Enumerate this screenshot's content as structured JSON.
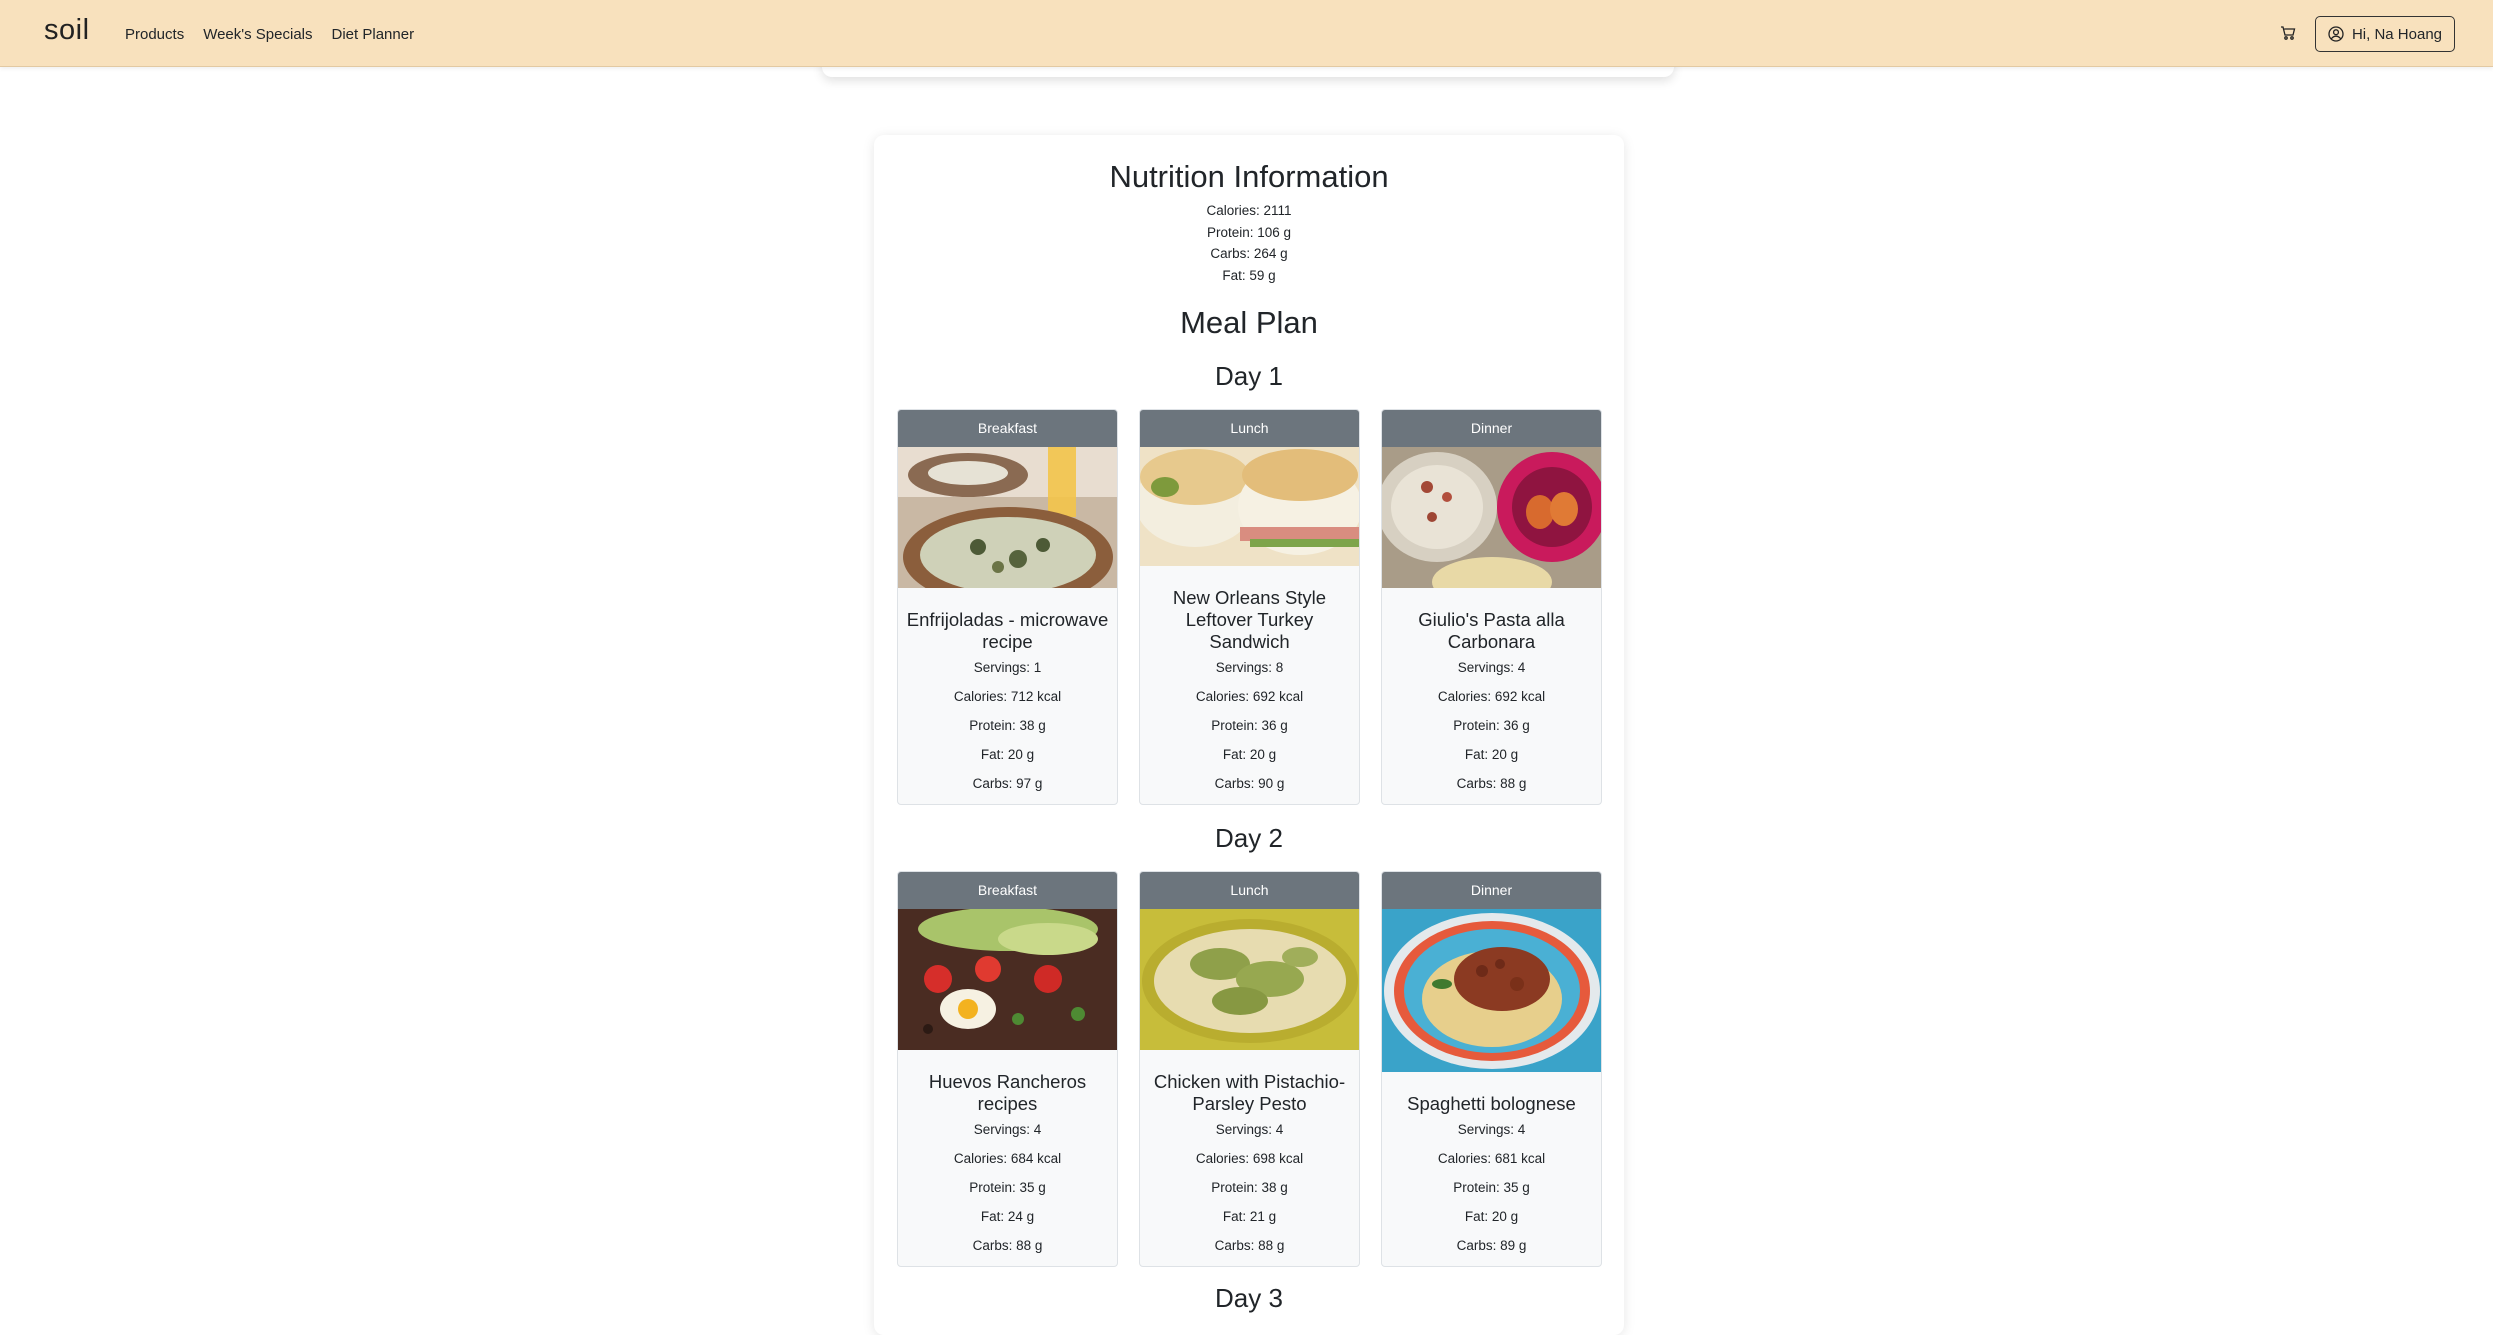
{
  "navbar": {
    "brand": "soil",
    "links": [
      "Products",
      "Week's Specials",
      "Diet Planner"
    ],
    "user_label": "Hi, Na Hoang"
  },
  "nutrition": {
    "title": "Nutrition Information",
    "lines": [
      "Calories: 2111",
      "Protein: 106 g",
      "Carbs: 264 g",
      "Fat: 59 g"
    ]
  },
  "meal_plan_title": "Meal Plan",
  "days": [
    {
      "title": "Day 1",
      "meals": [
        {
          "type": "Breakfast",
          "name": "Enfrijoladas - microwave recipe",
          "servings": "Servings: 1",
          "calories": "Calories: 712 kcal",
          "protein": "Protein: 38 g",
          "fat": "Fat: 20 g",
          "carbs": "Carbs: 97 g"
        },
        {
          "type": "Lunch",
          "name": "New Orleans Style Leftover Turkey Sandwich",
          "servings": "Servings: 8",
          "calories": "Calories: 692 kcal",
          "protein": "Protein: 36 g",
          "fat": "Fat: 20 g",
          "carbs": "Carbs: 90 g"
        },
        {
          "type": "Dinner",
          "name": "Giulio's Pasta alla Carbonara",
          "servings": "Servings: 4",
          "calories": "Calories: 692 kcal",
          "protein": "Protein: 36 g",
          "fat": "Fat: 20 g",
          "carbs": "Carbs: 88 g"
        }
      ]
    },
    {
      "title": "Day 2",
      "meals": [
        {
          "type": "Breakfast",
          "name": "Huevos Rancheros recipes",
          "servings": "Servings: 4",
          "calories": "Calories: 684 kcal",
          "protein": "Protein: 35 g",
          "fat": "Fat: 24 g",
          "carbs": "Carbs: 88 g"
        },
        {
          "type": "Lunch",
          "name": "Chicken with Pistachio-Parsley Pesto",
          "servings": "Servings: 4",
          "calories": "Calories: 698 kcal",
          "protein": "Protein: 38 g",
          "fat": "Fat: 21 g",
          "carbs": "Carbs: 88 g"
        },
        {
          "type": "Dinner",
          "name": "Spaghetti bolognese",
          "servings": "Servings: 4",
          "calories": "Calories: 681 kcal",
          "protein": "Protein: 35 g",
          "fat": "Fat: 20 g",
          "carbs": "Carbs: 89 g"
        }
      ]
    },
    {
      "title": "Day 3",
      "meals": []
    }
  ]
}
